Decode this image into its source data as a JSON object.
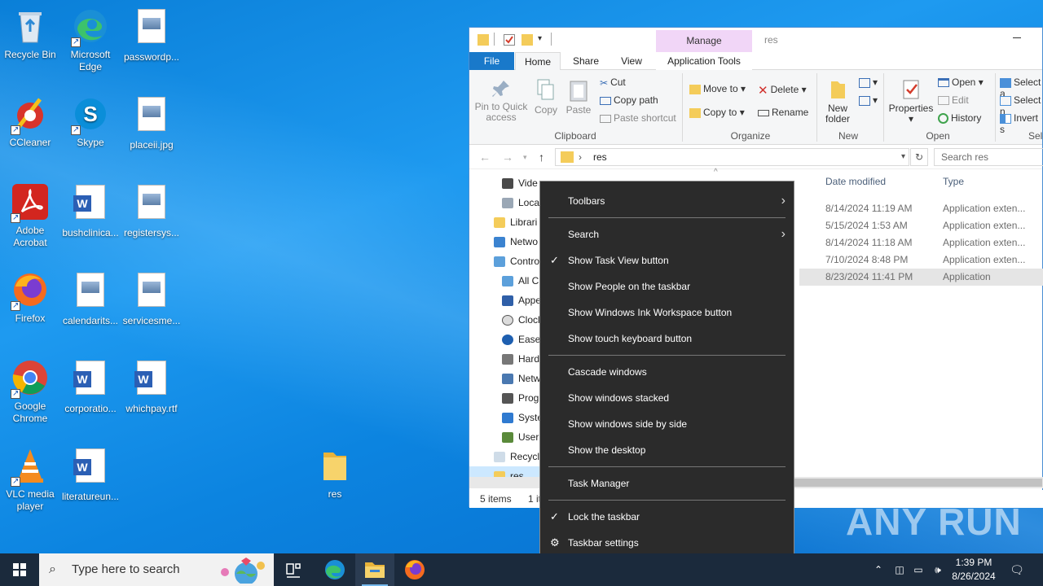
{
  "desktop": {
    "icons": [
      {
        "label": "Recycle Bin"
      },
      {
        "label": "Microsoft Edge"
      },
      {
        "label": "passwordp..."
      },
      {
        "label": "CCleaner"
      },
      {
        "label": "Skype"
      },
      {
        "label": "placeii.jpg"
      },
      {
        "label": "Adobe Acrobat"
      },
      {
        "label": "bushclinica..."
      },
      {
        "label": "registersys..."
      },
      {
        "label": "Firefox"
      },
      {
        "label": "calendarits..."
      },
      {
        "label": "servicesme..."
      },
      {
        "label": "Google Chrome"
      },
      {
        "label": "corporatio..."
      },
      {
        "label": "whichpay.rtf"
      },
      {
        "label": "VLC media player"
      },
      {
        "label": "literatureun..."
      },
      {
        "label": "res"
      }
    ]
  },
  "explorer": {
    "title": "res",
    "manage_tab": "Manage",
    "tabs": {
      "file": "File",
      "home": "Home",
      "share": "Share",
      "view": "View",
      "app_tools": "Application Tools"
    },
    "ribbon": {
      "pin": "Pin to Quick access",
      "copy": "Copy",
      "paste": "Paste",
      "cut": "Cut",
      "copy_path": "Copy path",
      "paste_shortcut": "Paste shortcut",
      "clipboard": "Clipboard",
      "move_to": "Move to",
      "copy_to": "Copy to",
      "delete": "Delete",
      "rename": "Rename",
      "organize": "Organize",
      "new_folder": "New folder",
      "new": "New",
      "properties": "Properties",
      "open": "Open",
      "edit": "Edit",
      "history": "History",
      "open_group": "Open",
      "select_all": "Select a",
      "select_none": "Select n",
      "invert": "Invert s",
      "select_group": "Sele"
    },
    "address": "res",
    "search_placeholder": "Search res",
    "nav": [
      "Vide",
      "Loca",
      "Librari",
      "Netwo",
      "Contro",
      "All C",
      "Appe",
      "Clock",
      "Ease",
      "Hard",
      "Netw",
      "Prog",
      "Syste",
      "User",
      "Recycl",
      "res"
    ],
    "columns": {
      "date": "Date modified",
      "type": "Type"
    },
    "files": [
      {
        "date": "8/14/2024 11:19 AM",
        "type": "Application exten..."
      },
      {
        "date": "5/15/2024 1:53 AM",
        "type": "Application exten..."
      },
      {
        "date": "8/14/2024 11:18 AM",
        "type": "Application exten..."
      },
      {
        "date": "7/10/2024 8:48 PM",
        "type": "Application exten..."
      },
      {
        "date": "8/23/2024 11:41 PM",
        "type": "Application"
      }
    ],
    "status": {
      "items": "5 items",
      "selected": "1 it"
    }
  },
  "context_menu": {
    "toolbars": "Toolbars",
    "search": "Search",
    "task_view": "Show Task View button",
    "people": "Show People on the taskbar",
    "ink": "Show Windows Ink Workspace button",
    "touch_kb": "Show touch keyboard button",
    "cascade": "Cascade windows",
    "stacked": "Show windows stacked",
    "side_by_side": "Show windows side by side",
    "desktop": "Show the desktop",
    "task_manager": "Task Manager",
    "lock": "Lock the taskbar",
    "settings": "Taskbar settings"
  },
  "watermark": "ANY RUN",
  "taskbar": {
    "search_placeholder": "Type here to search",
    "time": "1:39 PM",
    "date": "8/26/2024"
  },
  "colors": {
    "accent": "#1979ca",
    "menu_bg": "#2b2b2b",
    "taskbar_bg": "#1b2a3c",
    "manage_tab": "#f1d6f7"
  }
}
